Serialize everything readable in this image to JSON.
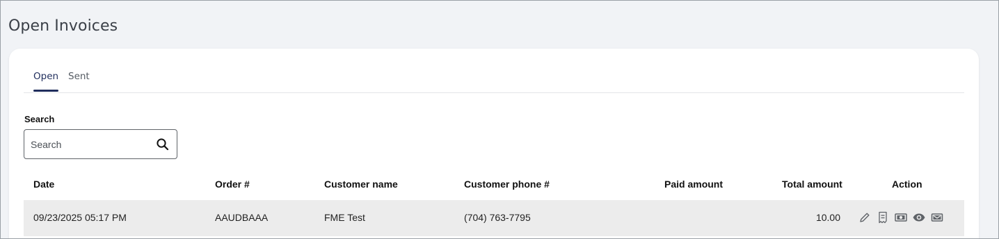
{
  "page": {
    "title": "Open Invoices"
  },
  "tabs": [
    {
      "label": "Open",
      "active": true
    },
    {
      "label": "Sent",
      "active": false
    }
  ],
  "search": {
    "label": "Search",
    "placeholder": "Search",
    "value": ""
  },
  "table": {
    "headers": {
      "date": "Date",
      "order": "Order #",
      "customer_name": "Customer name",
      "customer_phone": "Customer phone #",
      "paid_amount": "Paid amount",
      "total_amount": "Total amount",
      "action": "Action"
    },
    "rows": [
      {
        "date": "09/23/2025 05:17 PM",
        "order": "AAUDBAAA",
        "customer_name": "FME Test",
        "customer_phone": "(704) 763-7795",
        "paid_amount": "",
        "total_amount": "10.00",
        "actions": [
          "edit-icon",
          "receipt-icon",
          "cash-icon",
          "view-icon",
          "send-icon"
        ]
      }
    ]
  },
  "colors": {
    "accent": "#1f2d5c",
    "page_background": "#f1f3f6",
    "row_background": "#ececec",
    "icon": "#5f6368"
  }
}
